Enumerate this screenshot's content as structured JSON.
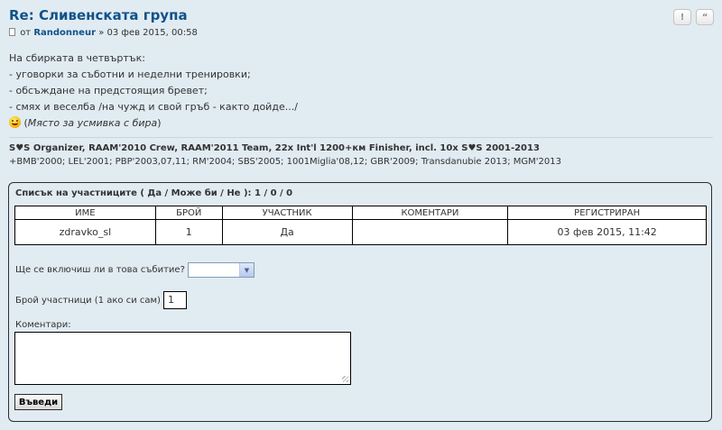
{
  "post": {
    "title_prefix": "Re:",
    "title_text": "Сливенската група",
    "buttons": {
      "report": "!",
      "quote": "“"
    },
    "author_prefix": "от",
    "author_name": "Randonneur",
    "author_sep": "»",
    "date": "03 фев 2015, 00:58"
  },
  "content": {
    "lines": [
      "На сбирката в четвъртък:",
      "- уговорки за съботни и неделни тренировки;",
      "- обсъждане на предстоящия бревет;",
      "- смях и веселба /на чужд и свой гръб - както дойде.../"
    ],
    "smiley_icon": "grin-smiley-icon",
    "smiley_caption": "Място за усмивка с бира"
  },
  "signature": {
    "line1": "S♥S Organizer, RAAM'2010 Crew, RAAM'2011 Team, 22x Int'l 1200+км Finisher, incl. 10x S♥S 2001-2013",
    "line2": "+BMB'2000; LEL'2001; PBP'2003,07,11; RM'2004; SBS'2005; 1001Miglia'08,12; GBR'2009; Transdanubie 2013; MGM'2013"
  },
  "event": {
    "title": "Списък на участниците ( Да / Може би / Не ): 1 / 0 / 0",
    "columns": [
      "ИМЕ",
      "БРОЙ",
      "УЧАСТНИК",
      "КОМЕНТАРИ",
      "РЕГИСТРИРАН"
    ],
    "rows": [
      {
        "name": "zdravko_sl",
        "count": "1",
        "status": "Да",
        "comment": "",
        "registered": "03 фев 2015, 11:42"
      }
    ],
    "q_attend": "Ще се включиш ли в това събитие?",
    "attend_value": "",
    "q_count": "Брой участници (1 ако си сам)",
    "count_value": "1",
    "q_comment": "Коментари:",
    "comment_value": "",
    "submit_label": "Въведи"
  }
}
